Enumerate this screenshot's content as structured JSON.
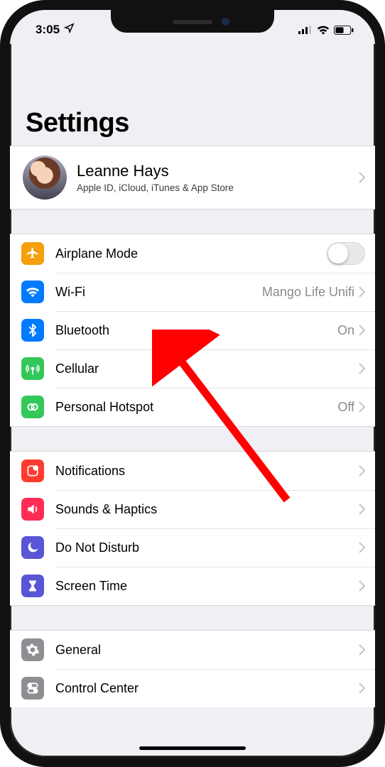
{
  "status": {
    "time": "3:05",
    "location_icon": "location-arrow-icon",
    "cell_icon": "cellular-signal-icon",
    "wifi_icon": "wifi-icon",
    "battery_icon": "battery-icon"
  },
  "page": {
    "title": "Settings"
  },
  "profile": {
    "name": "Leanne Hays",
    "subtitle": "Apple ID, iCloud, iTunes & App Store"
  },
  "groups": [
    {
      "rows": [
        {
          "icon": "airplane-icon",
          "icon_bg": "#f59f0a",
          "label": "Airplane Mode",
          "control": "toggle",
          "toggle_on": false
        },
        {
          "icon": "wifi-icon",
          "icon_bg": "#007aff",
          "label": "Wi-Fi",
          "value": "Mango Life Unifi",
          "control": "disclosure"
        },
        {
          "icon": "bluetooth-icon",
          "icon_bg": "#007aff",
          "label": "Bluetooth",
          "value": "On",
          "control": "disclosure"
        },
        {
          "icon": "cellular-icon",
          "icon_bg": "#34c759",
          "label": "Cellular",
          "control": "disclosure"
        },
        {
          "icon": "hotspot-icon",
          "icon_bg": "#34c759",
          "label": "Personal Hotspot",
          "value": "Off",
          "control": "disclosure"
        }
      ]
    },
    {
      "rows": [
        {
          "icon": "notifications-icon",
          "icon_bg": "#ff3b30",
          "label": "Notifications",
          "control": "disclosure"
        },
        {
          "icon": "sounds-icon",
          "icon_bg": "#ff2d55",
          "label": "Sounds & Haptics",
          "control": "disclosure"
        },
        {
          "icon": "dnd-icon",
          "icon_bg": "#5856d6",
          "label": "Do Not Disturb",
          "control": "disclosure"
        },
        {
          "icon": "screentime-icon",
          "icon_bg": "#5856d6",
          "label": "Screen Time",
          "control": "disclosure"
        }
      ]
    },
    {
      "rows": [
        {
          "icon": "general-icon",
          "icon_bg": "#8e8e93",
          "label": "General",
          "control": "disclosure"
        },
        {
          "icon": "controlcenter-icon",
          "icon_bg": "#8e8e93",
          "label": "Control Center",
          "control": "disclosure"
        }
      ]
    }
  ],
  "annotation": {
    "arrow_color": "#ff0000",
    "target_row": "Bluetooth"
  }
}
